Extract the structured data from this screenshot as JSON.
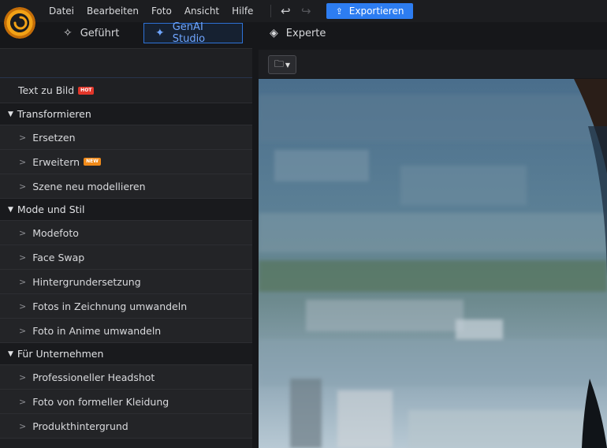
{
  "menu": {
    "items": [
      "Datei",
      "Bearbeiten",
      "Foto",
      "Ansicht",
      "Hilfe"
    ]
  },
  "toolbar": {
    "export_label": "Exportieren"
  },
  "modes": [
    {
      "label": "Geführt",
      "icon": "magic-wand-icon"
    },
    {
      "label": "GenAI Studio",
      "icon": "sparkle-icon"
    },
    {
      "label": "Experte",
      "icon": "layers-icon"
    }
  ],
  "sidebar": {
    "top_item": {
      "label": "Text zu Bild",
      "badge": "HOT"
    },
    "sections": [
      {
        "title": "Transformieren",
        "items": [
          {
            "label": "Ersetzen",
            "badge": ""
          },
          {
            "label": "Erweitern",
            "badge": "NEW"
          },
          {
            "label": "Szene neu modellieren",
            "badge": ""
          }
        ]
      },
      {
        "title": "Mode und Stil",
        "items": [
          {
            "label": "Modefoto",
            "badge": ""
          },
          {
            "label": "Face Swap",
            "badge": ""
          },
          {
            "label": "Hintergrundersetzung",
            "badge": ""
          },
          {
            "label": "Fotos in Zeichnung umwandeln",
            "badge": ""
          },
          {
            "label": "Foto in Anime umwandeln",
            "badge": ""
          }
        ]
      },
      {
        "title": "Für Unternehmen",
        "items": [
          {
            "label": "Professioneller Headshot",
            "badge": ""
          },
          {
            "label": "Foto von formeller Kleidung",
            "badge": ""
          },
          {
            "label": "Produkthintergrund",
            "badge": ""
          }
        ]
      }
    ]
  },
  "colors": {
    "accent": "#2d7df1",
    "hot_badge": "#e2362a",
    "new_badge": "#f08a1a"
  }
}
